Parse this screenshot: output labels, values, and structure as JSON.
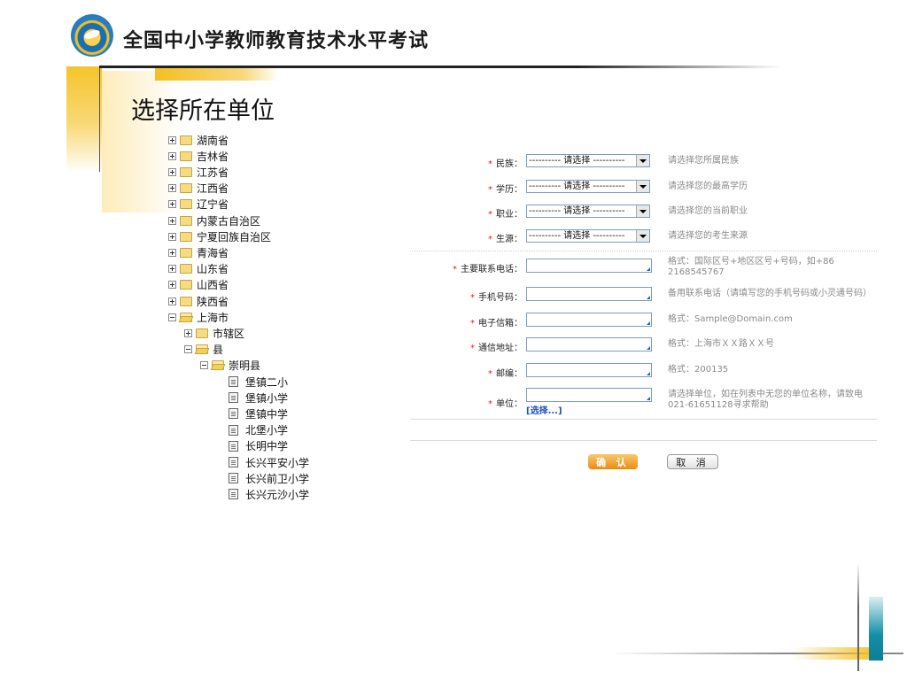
{
  "header": {
    "title": "全国中小学教师教育技术水平考试"
  },
  "page": {
    "heading": "选择所在单位"
  },
  "tree": [
    {
      "label": "湖南省",
      "depth": 0,
      "type": "folder",
      "state": "collapsed"
    },
    {
      "label": "吉林省",
      "depth": 0,
      "type": "folder",
      "state": "collapsed"
    },
    {
      "label": "江苏省",
      "depth": 0,
      "type": "folder",
      "state": "collapsed"
    },
    {
      "label": "江西省",
      "depth": 0,
      "type": "folder",
      "state": "collapsed"
    },
    {
      "label": "辽宁省",
      "depth": 0,
      "type": "folder",
      "state": "collapsed"
    },
    {
      "label": "内蒙古自治区",
      "depth": 0,
      "type": "folder",
      "state": "collapsed"
    },
    {
      "label": "宁夏回族自治区",
      "depth": 0,
      "type": "folder",
      "state": "collapsed"
    },
    {
      "label": "青海省",
      "depth": 0,
      "type": "folder",
      "state": "collapsed"
    },
    {
      "label": "山东省",
      "depth": 0,
      "type": "folder",
      "state": "collapsed"
    },
    {
      "label": "山西省",
      "depth": 0,
      "type": "folder",
      "state": "collapsed"
    },
    {
      "label": "陕西省",
      "depth": 0,
      "type": "folder",
      "state": "collapsed"
    },
    {
      "label": "上海市",
      "depth": 0,
      "type": "folder",
      "state": "expanded"
    },
    {
      "label": "市辖区",
      "depth": 1,
      "type": "folder",
      "state": "collapsed"
    },
    {
      "label": "县",
      "depth": 1,
      "type": "folder",
      "state": "expanded"
    },
    {
      "label": "崇明县",
      "depth": 2,
      "type": "folder",
      "state": "expanded"
    },
    {
      "label": "堡镇二小",
      "depth": 3,
      "type": "leaf"
    },
    {
      "label": "堡镇小学",
      "depth": 3,
      "type": "leaf"
    },
    {
      "label": "堡镇中学",
      "depth": 3,
      "type": "leaf"
    },
    {
      "label": "北堡小学",
      "depth": 3,
      "type": "leaf"
    },
    {
      "label": "长明中学",
      "depth": 3,
      "type": "leaf"
    },
    {
      "label": "长兴平安小学",
      "depth": 3,
      "type": "leaf"
    },
    {
      "label": "长兴前卫小学",
      "depth": 3,
      "type": "leaf"
    },
    {
      "label": "长兴元沙小学",
      "depth": 3,
      "type": "leaf"
    }
  ],
  "form": {
    "required_mark": "*",
    "fields": {
      "ethnicity": {
        "label": "民族：",
        "value": "---------- 请选择 ----------",
        "hint": "请选择您所属民族"
      },
      "education": {
        "label": "学历：",
        "value": "---------- 请选择 ----------",
        "hint": "请选择您的最高学历"
      },
      "occupation": {
        "label": "职业：",
        "value": "---------- 请选择 ----------",
        "hint": "请选择您的当前职业"
      },
      "source": {
        "label": "生源：",
        "value": "---------- 请选择 ----------",
        "hint": "请选择您的考生来源"
      },
      "phone": {
        "label": "主要联系电话：",
        "value": "",
        "hint": "格式：国际区号+地区区号+号码，如+86 2168545767"
      },
      "mobile": {
        "label": "手机号码：",
        "value": "",
        "hint": "备用联系电话（请填写您的手机号码或小灵通号码）"
      },
      "email": {
        "label": "电子信箱：",
        "value": "",
        "hint": "格式：Sample@Domain.com"
      },
      "address": {
        "label": "通信地址：",
        "value": "",
        "hint": "格式：上海市ＸＸ路ＸＸ号"
      },
      "postcode": {
        "label": "邮编：",
        "value": "",
        "hint": "格式：200135"
      },
      "unit": {
        "label": "单位：",
        "value": "",
        "hint": "请选择单位，如在列表中无您的单位名称，请致电021-61651128寻求帮助",
        "link": "[选择...]"
      }
    }
  },
  "buttons": {
    "confirm": "确 认",
    "cancel": "取 消"
  },
  "colors": {
    "accent_gold": "#f5c026",
    "required": "#e02020",
    "link": "#1d4fb8",
    "teal": "#118fa8"
  }
}
